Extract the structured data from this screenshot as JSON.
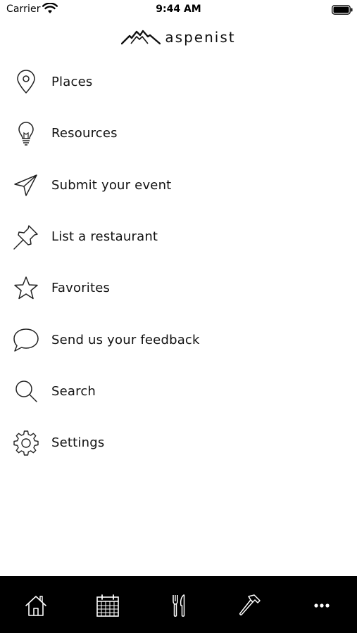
{
  "status_bar": {
    "carrier": "Carrier",
    "time": "9:44 AM",
    "wifi_icon": "wifi-icon",
    "battery_icon": "battery-icon"
  },
  "logo": {
    "text": "aspenist",
    "icon": "mountain-icon"
  },
  "menu": {
    "items": [
      {
        "label": "Places",
        "icon": "map-pin-icon"
      },
      {
        "label": "Resources",
        "icon": "lightbulb-icon"
      },
      {
        "label": "Submit your event",
        "icon": "paper-plane-icon"
      },
      {
        "label": "List a restaurant",
        "icon": "pushpin-icon"
      },
      {
        "label": "Favorites",
        "icon": "star-icon"
      },
      {
        "label": "Send us your feedback",
        "icon": "speech-bubble-icon"
      },
      {
        "label": "Search",
        "icon": "search-icon"
      },
      {
        "label": "Settings",
        "icon": "gear-icon"
      }
    ]
  },
  "tab_bar": {
    "tabs": [
      {
        "icon": "home-icon"
      },
      {
        "icon": "calendar-icon"
      },
      {
        "icon": "fork-knife-icon"
      },
      {
        "icon": "hammer-icon"
      },
      {
        "icon": "more-icon"
      }
    ]
  },
  "colors": {
    "background": "#ffffff",
    "text": "#111111",
    "tab_bar": "#000000",
    "tab_icon": "#ffffff"
  }
}
